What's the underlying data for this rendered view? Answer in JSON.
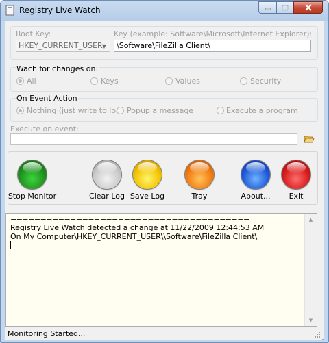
{
  "window": {
    "title": "Registry Live Watch",
    "icon": "registry-app-icon"
  },
  "titlebar_buttons": {
    "minimize": "minimize-icon",
    "maximize": "maximize-icon",
    "close": "close-icon"
  },
  "root_key": {
    "label": "Root Key:",
    "value": "HKEY_CURRENT_USER"
  },
  "key": {
    "label": "Key (example: Software\\Microsoft\\Internet Explorer):",
    "value": "\\Software\\FileZilla Client\\"
  },
  "watch": {
    "label": "Wach for changes on:",
    "options": [
      "All",
      "Keys",
      "Values",
      "Security"
    ],
    "selected": "All"
  },
  "event_action": {
    "label": "On Event Action",
    "options": [
      "Nothing (just write to log)",
      "Popup a message",
      "Execute a program"
    ],
    "selected": "Nothing (just write to log)"
  },
  "execute": {
    "label": "Execute on event:",
    "value": "",
    "browse_icon": "folder-open-icon"
  },
  "buttons": [
    {
      "label": "Stop Monitor",
      "color": "#1f8f1f"
    },
    {
      "label": "Clear Log",
      "color": "#bcbcbc"
    },
    {
      "label": "Save Log",
      "color": "#f2c200"
    },
    {
      "label": "Tray",
      "color": "#f07a10"
    },
    {
      "label": "About...",
      "color": "#1e58d8"
    },
    {
      "label": "Exit",
      "color": "#d61a1a"
    }
  ],
  "log": {
    "separator": "========================================",
    "line1": "Registry Live Watch detected a change at 11/22/2009 12:44:53 AM",
    "line2": "On My Computer\\HKEY_CURRENT_USER\\\\Software\\FileZilla Client\\"
  },
  "status": {
    "text": "Monitoring Started..."
  }
}
